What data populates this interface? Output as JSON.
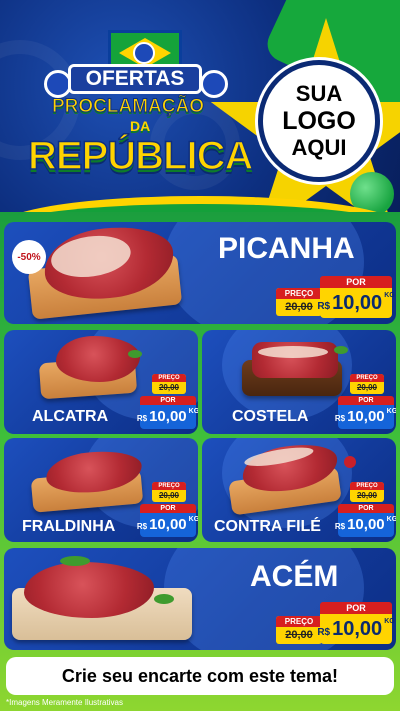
{
  "header": {
    "ofertas": "OFERTAS",
    "proclamacao": "PROCLAMAÇÃO",
    "da": "DA",
    "republica": "REPÚBLICA",
    "logo_line1": "SUA",
    "logo_line2": "LOGO",
    "logo_line3": "AQUI"
  },
  "products": [
    {
      "name": "PICANHA",
      "discount": "-50%",
      "preco_label": "PREÇO",
      "old_price": "20,00",
      "por_label": "POR",
      "currency": "R$",
      "price": "10,00",
      "unit": "KG"
    },
    {
      "name": "ALCATRA",
      "preco_label": "PREÇO",
      "old_price": "20,00",
      "por_label": "POR",
      "currency": "R$",
      "price": "10,00",
      "unit": "KG"
    },
    {
      "name": "COSTELA",
      "preco_label": "PREÇO",
      "old_price": "20,00",
      "por_label": "POR",
      "currency": "R$",
      "price": "10,00",
      "unit": "KG"
    },
    {
      "name": "FRALDINHA",
      "preco_label": "PREÇO",
      "old_price": "20,00",
      "por_label": "POR",
      "currency": "R$",
      "price": "10,00",
      "unit": "KG"
    },
    {
      "name": "CONTRA FILÉ",
      "preco_label": "PREÇO",
      "old_price": "20,00",
      "por_label": "POR",
      "currency": "R$",
      "price": "10,00",
      "unit": "KG"
    },
    {
      "name": "ACÉM",
      "preco_label": "PREÇO",
      "old_price": "20,00",
      "por_label": "POR",
      "currency": "R$",
      "price": "10,00",
      "unit": "KG"
    }
  ],
  "cta": "Crie seu encarte com este tema!",
  "footnote": "*Imagens Meramente Ilustrativas",
  "colors": {
    "blue": "#123a9a",
    "green": "#1b9e3e",
    "yellow": "#ffd400",
    "red": "#d71f1f"
  }
}
